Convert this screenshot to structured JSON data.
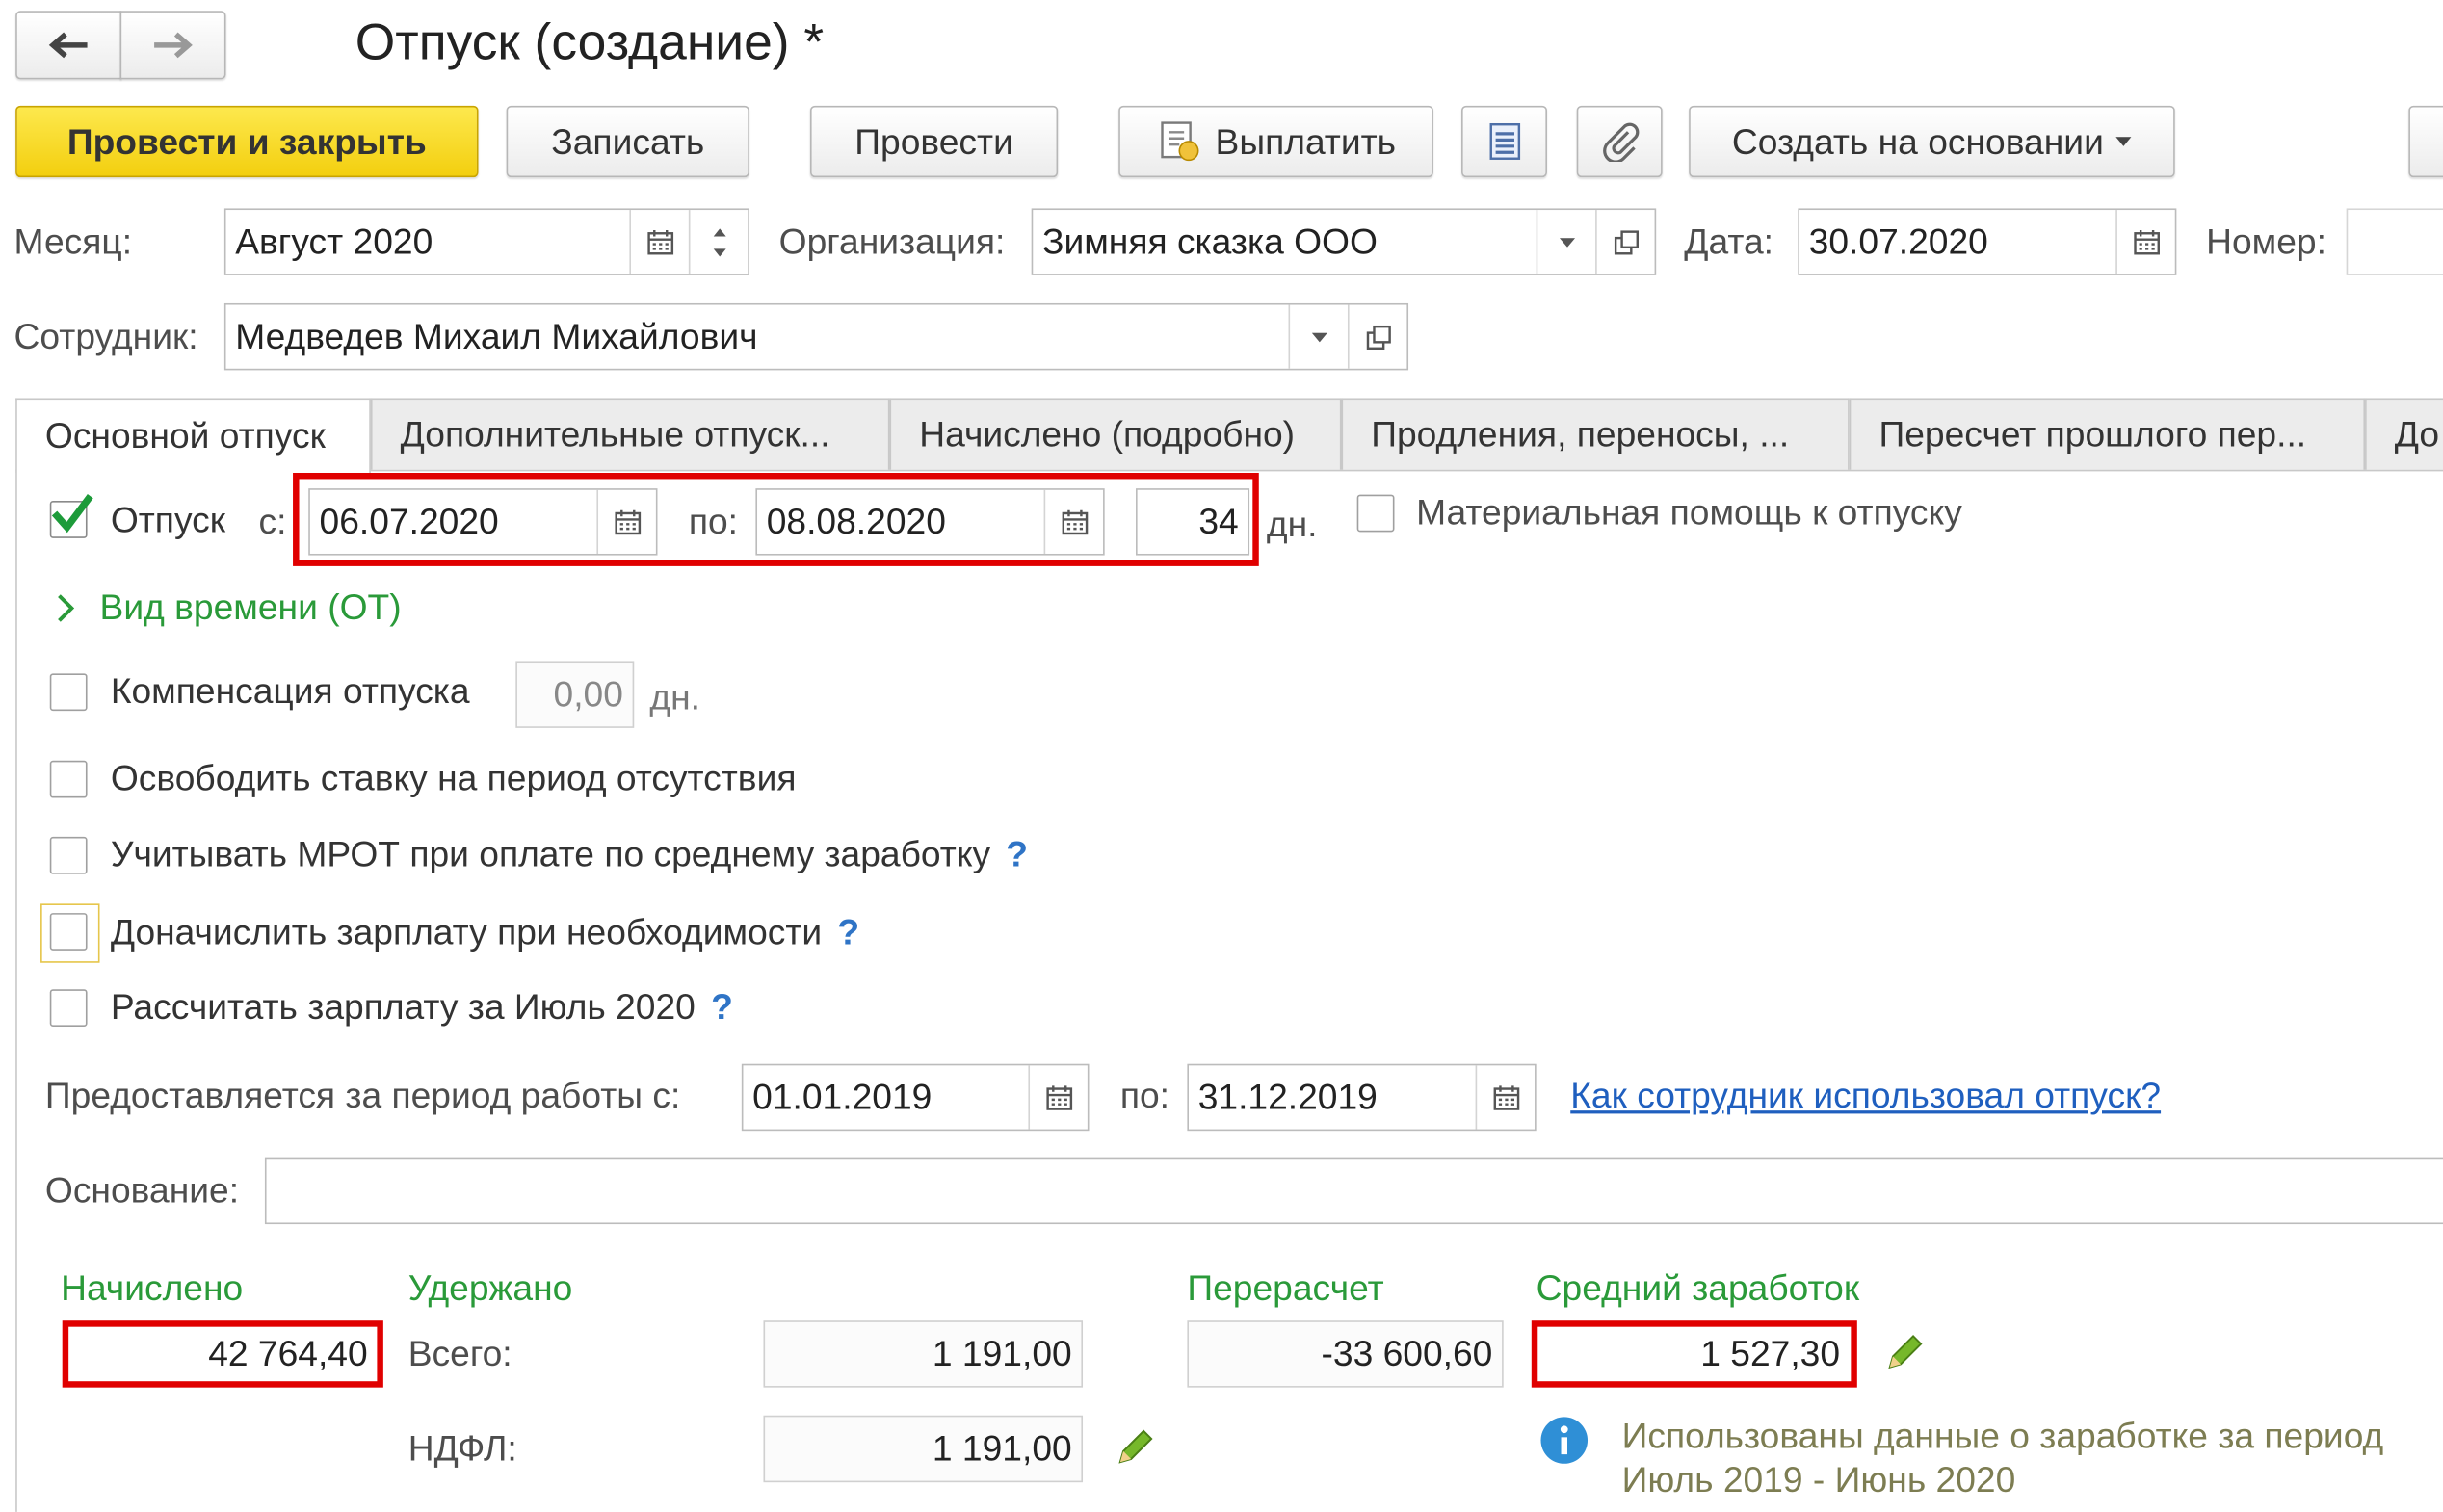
{
  "title": "Отпуск (создание) *",
  "toolbar": {
    "post_close": "Провести и закрыть",
    "save": "Записать",
    "post": "Провести",
    "pay": "Выплатить",
    "create_based": "Создать на основании"
  },
  "header": {
    "month_label": "Месяц:",
    "month_value": "Август 2020",
    "org_label": "Организация:",
    "org_value": "Зимняя сказка ООО",
    "date_label": "Дата:",
    "date_value": "30.07.2020",
    "number_label": "Номер:",
    "employee_label": "Сотрудник:",
    "employee_value": "Медведев Михаил Михайлович"
  },
  "tabs": [
    {
      "label": "Основной отпуск"
    },
    {
      "label": "Дополнительные отпуск..."
    },
    {
      "label": "Начислено (подробно)"
    },
    {
      "label": "Продления, переносы, ..."
    },
    {
      "label": "Пересчет прошлого пер..."
    },
    {
      "label": "До"
    }
  ],
  "main": {
    "vacation_label": "Отпуск",
    "from_label": "с:",
    "from_value": "06.07.2020",
    "to_label": "по:",
    "to_value": "08.08.2020",
    "days_value": "34",
    "days_unit": "дн.",
    "material_aid": "Материальная помощь к отпуску",
    "time_type": "Вид времени (ОТ)",
    "compensation": "Компенсация отпуска",
    "compensation_value": "0,00",
    "compensation_unit": "дн.",
    "free_rate": "Освободить ставку на период отсутствия",
    "mrot": "Учитывать МРОТ при оплате по среднему заработку",
    "accrue_salary": "Доначислить зарплату при необходимости",
    "calc_salary": "Рассчитать зарплату за Июль 2020",
    "period_label": "Предоставляется за период работы с:",
    "period_from": "01.01.2019",
    "period_to_label": "по:",
    "period_to": "31.12.2019",
    "usage_link": "Как сотрудник использовал отпуск?",
    "basis_label": "Основание:",
    "basis_value": "",
    "q": "?"
  },
  "summary": {
    "accrued_label": "Начислено",
    "accrued_value": "42 764,40",
    "withheld_label": "Удержано",
    "total_label": "Всего:",
    "total_value": "1 191,00",
    "ndfl_label": "НДФЛ:",
    "ndfl_value": "1 191,00",
    "recalc_label": "Перерасчет",
    "recalc_value": "-33 600,60",
    "avg_label": "Средний заработок",
    "avg_value": "1 527,30",
    "info_line1": "Использованы данные о заработке за период",
    "info_line2": "Июль 2019 - Июнь 2020"
  },
  "colors": {
    "primary_button": "#f5d31a",
    "green_text": "#2a9a39",
    "link": "#1f5fbf",
    "highlight": "#e00000",
    "info_icon": "#2f8fd6"
  },
  "icons": [
    "back-arrow-icon",
    "forward-arrow-icon",
    "calendar-icon",
    "spin-icon",
    "dropdown-icon",
    "open-icon",
    "pay-icon",
    "list-icon",
    "paperclip-icon",
    "checkmark-icon",
    "chevron-right-icon",
    "pencil-icon",
    "info-icon"
  ]
}
